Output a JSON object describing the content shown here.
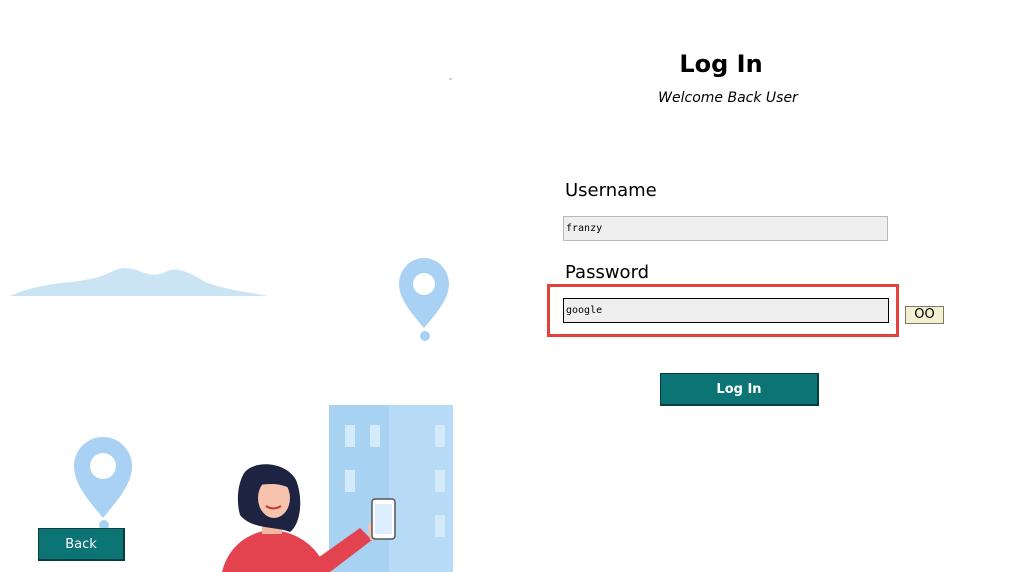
{
  "header": {
    "title": "Log In",
    "subtitle": "Welcome Back User"
  },
  "form": {
    "username_label": "Username",
    "username_value": "franzy",
    "password_label": "Password",
    "password_value": "google",
    "toggle_label": "OO",
    "submit_label": "Log In"
  },
  "nav": {
    "back_label": "Back"
  },
  "colors": {
    "primary_button": "#0c7474",
    "highlight_border": "#e2423a",
    "illustration_blue": "#9fcdf2",
    "figure_shirt": "#e2434e"
  },
  "icons": [
    "map-pin-icon",
    "map-pin-icon",
    "cloud-icon",
    "building-icon",
    "person-illustration",
    "smartphone-icon"
  ]
}
